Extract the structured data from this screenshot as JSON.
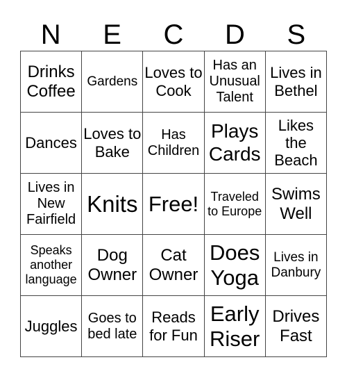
{
  "header": {
    "letters": [
      "N",
      "E",
      "C",
      "D",
      "S"
    ]
  },
  "cells": [
    [
      "Drinks Coffee",
      "Gardens",
      "Loves to Cook",
      "Has an Unusual Talent",
      "Lives in Bethel"
    ],
    [
      "Dances",
      "Loves to Bake",
      "Has Children",
      "Plays Cards",
      "Likes the Beach"
    ],
    [
      "Lives in New Fairfield",
      "Knits",
      "Free!",
      "Traveled to Europe",
      "Swims Well"
    ],
    [
      "Speaks another language",
      "Dog Owner",
      "Cat Owner",
      "Does Yoga",
      "Lives in Danbury"
    ],
    [
      "Juggles",
      "Goes to bed late",
      "Reads for Fun",
      "Early Riser",
      "Drives Fast"
    ]
  ]
}
